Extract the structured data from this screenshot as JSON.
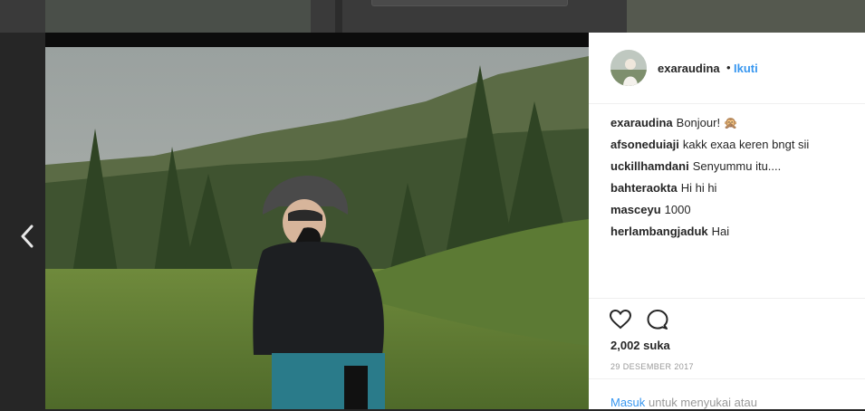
{
  "post": {
    "username": "exaraudina",
    "separator": "•",
    "follow_label": "Ikuti"
  },
  "comments": [
    {
      "user": "exaraudina",
      "text": "Bonjour! 🙊"
    },
    {
      "user": "afsoneduiaji",
      "text": "kakk exaa keren bngt sii"
    },
    {
      "user": "uckillhamdani",
      "text": "Senyummu itu...."
    },
    {
      "user": "bahteraokta",
      "text": "Hi hi hi"
    },
    {
      "user": "masceyu",
      "text": "1000"
    },
    {
      "user": "herlambangjaduk",
      "text": "Hai"
    }
  ],
  "stats": {
    "likes": "2,002 suka",
    "date": "29 DESEMBER 2017"
  },
  "login": {
    "link": "Masuk",
    "text": "untuk menyukai atau"
  },
  "icons": {
    "prev": "chevron-left-icon",
    "like": "heart-icon",
    "comment": "comment-icon"
  },
  "colors": {
    "accent": "#3897f0",
    "backdrop": "#262626"
  }
}
